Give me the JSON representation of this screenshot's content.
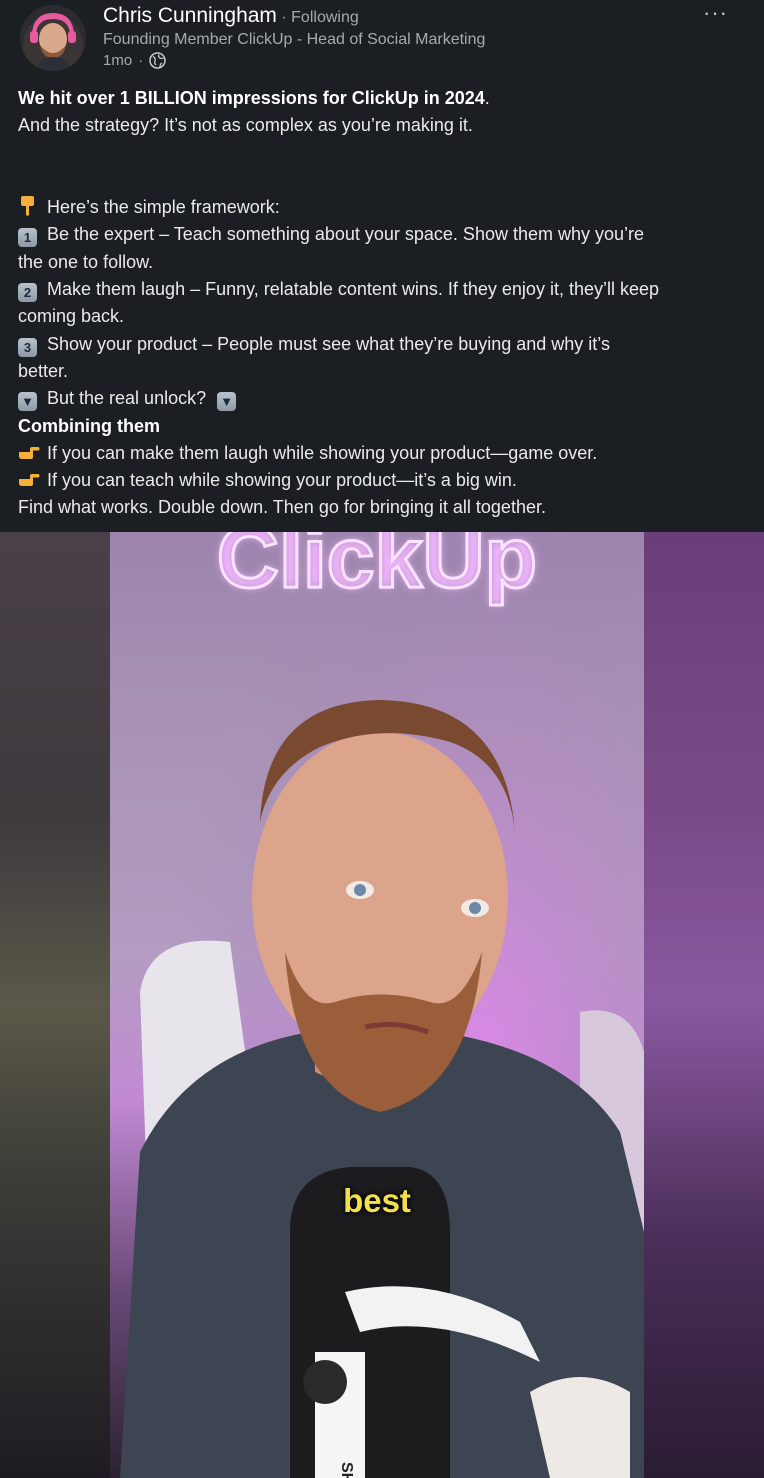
{
  "author": {
    "name": "Chris Cunningham",
    "separator": "·",
    "follow_status": "Following",
    "headline": "Founding Member ClickUp - Head of Social Marketing",
    "time_ago": "1mo",
    "visibility_icon": "globe-icon"
  },
  "menu": {
    "more_label": "···"
  },
  "post": {
    "line1_bold": "We hit over 1 BILLION impressions for ClickUp in 2024",
    "line1_tail": ".",
    "line2": "And the strategy? It’s not as complex as you’re making it.",
    "framework_intro": "Here’s the simple framework:",
    "item1_key": "1",
    "item1_text": "Be the expert – Teach something about your space. Show them why you’re",
    "item1_cont": "the one to follow.",
    "item2_key": "2",
    "item2_text": "Make them laugh – Funny, relatable content wins. If they enjoy it, they’ll keep",
    "item2_cont": "coming back.",
    "item3_key": "3",
    "item3_text": "Show your product – People must see what they’re buying and why it’s",
    "item3_cont": "better.",
    "unlock_text": "But the real unlock?",
    "combining_title": "Combining them",
    "combo1": "If you can make them laugh while showing your product—game over.",
    "combo2": "If you can teach while showing your product—it’s a big win.",
    "closing": "Find what works. Double down. Then go for bringing it all together."
  },
  "video": {
    "sign_text": "ClickUp",
    "caption": "best",
    "mic_brand": "SHURE"
  },
  "colors": {
    "background": "#1b1f23",
    "text": "#e9eaeb",
    "muted": "#a7aaad",
    "caption": "#f3e04b"
  }
}
